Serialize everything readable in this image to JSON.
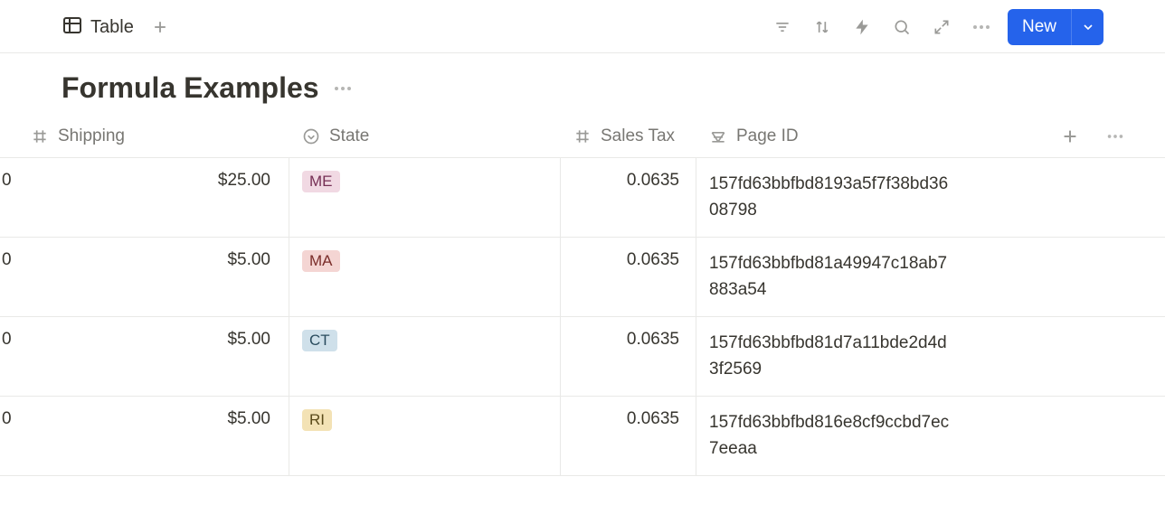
{
  "topbar": {
    "view_label": "Table",
    "new_label": "New"
  },
  "title": "Formula Examples",
  "columns": {
    "shipping": "Shipping",
    "state": "State",
    "sales_tax": "Sales Tax",
    "page_id": "Page ID"
  },
  "tag_colors": {
    "ME": "tag-pink",
    "MA": "tag-red",
    "CT": "tag-blue",
    "RI": "tag-yellow"
  },
  "rows": [
    {
      "leading": "0",
      "shipping": "$25.00",
      "state": "ME",
      "sales_tax": "0.0635",
      "page_id": "157fd63bbfbd8193a5f7f38bd3608798"
    },
    {
      "leading": "0",
      "shipping": "$5.00",
      "state": "MA",
      "sales_tax": "0.0635",
      "page_id": "157fd63bbfbd81a49947c18ab7883a54"
    },
    {
      "leading": "0",
      "shipping": "$5.00",
      "state": "CT",
      "sales_tax": "0.0635",
      "page_id": "157fd63bbfbd81d7a11bde2d4d3f2569"
    },
    {
      "leading": "0",
      "shipping": "$5.00",
      "state": "RI",
      "sales_tax": "0.0635",
      "page_id": "157fd63bbfbd816e8cf9ccbd7ec7eeaa"
    }
  ]
}
